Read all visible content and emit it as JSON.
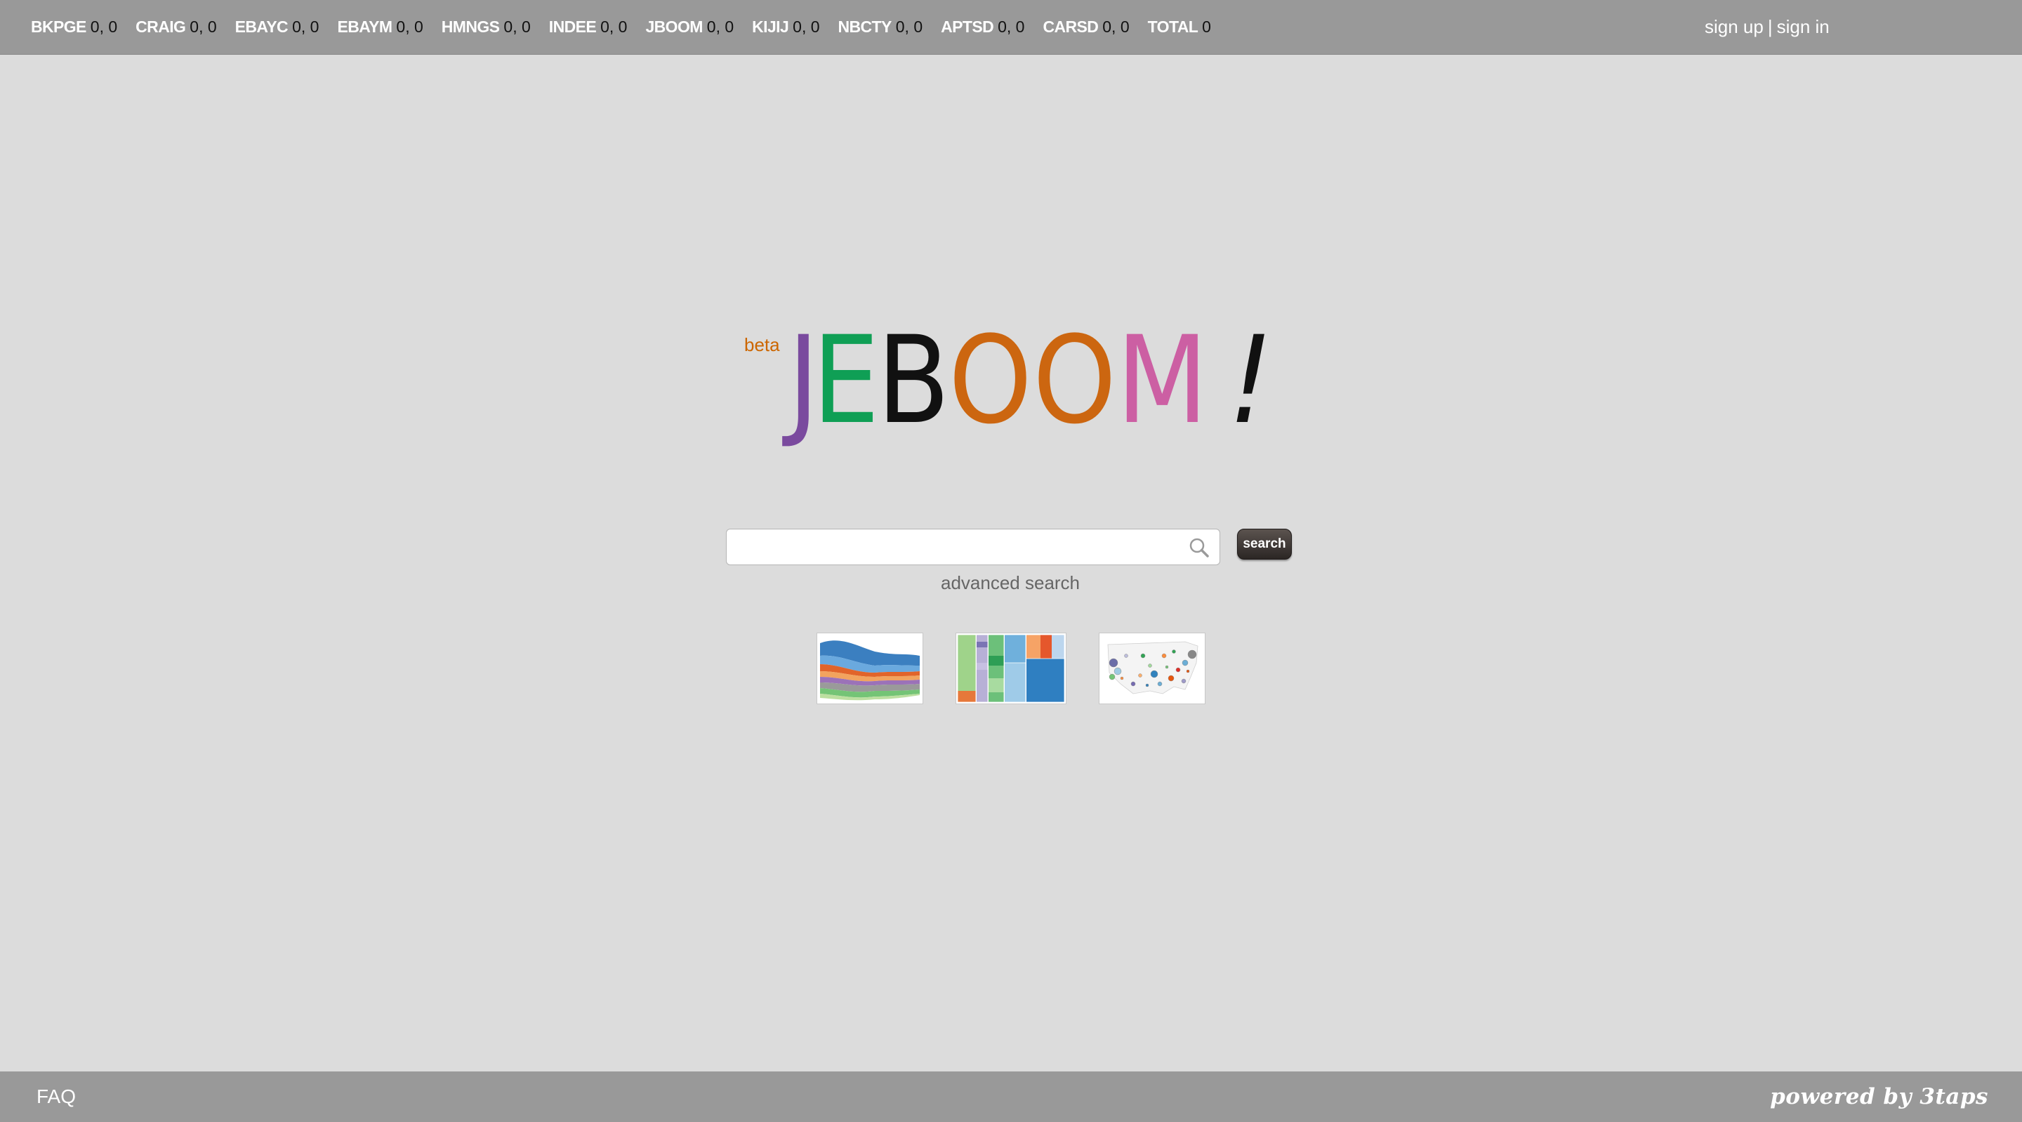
{
  "ticker": [
    {
      "code": "BKPGE",
      "value": "0, 0"
    },
    {
      "code": "CRAIG",
      "value": "0, 0"
    },
    {
      "code": "EBAYC",
      "value": "0, 0"
    },
    {
      "code": "EBAYM",
      "value": "0, 0"
    },
    {
      "code": "HMNGS",
      "value": "0, 0"
    },
    {
      "code": "INDEE",
      "value": "0, 0"
    },
    {
      "code": "JBOOM",
      "value": "0, 0"
    },
    {
      "code": "KIJIJ",
      "value": "0, 0"
    },
    {
      "code": "NBCTY",
      "value": "0, 0"
    },
    {
      "code": "APTSD",
      "value": "0, 0"
    },
    {
      "code": "CARSD",
      "value": "0, 0"
    },
    {
      "code": "TOTAL",
      "value": "0"
    }
  ],
  "auth": {
    "sign_up": "sign up",
    "separator": "|",
    "sign_in": "sign in"
  },
  "logo": {
    "beta": "beta",
    "letters": [
      {
        "char": "J",
        "color": "#7a4a9e"
      },
      {
        "char": "E",
        "color": "#0f9f55"
      },
      {
        "char": "B",
        "color": "#111111"
      },
      {
        "char": "O",
        "color": "#cc6610"
      },
      {
        "char": "O",
        "color": "#cc6610"
      },
      {
        "char": "M",
        "color": "#cc5fa3"
      },
      {
        "char": "!",
        "color": "#111111"
      }
    ]
  },
  "search": {
    "placeholder": "",
    "value": "",
    "button_label": "search",
    "advanced_label": "advanced search",
    "icon": "search-icon"
  },
  "thumbnails": [
    {
      "name": "streamgraph-thumbnail"
    },
    {
      "name": "treemap-thumbnail"
    },
    {
      "name": "us-map-thumbnail"
    }
  ],
  "footer": {
    "faq": "FAQ",
    "powered_by": "powered by 3taps"
  },
  "colors": {
    "bar": "#999999",
    "background": "#dcdcdc",
    "beta": "#cc6600"
  }
}
